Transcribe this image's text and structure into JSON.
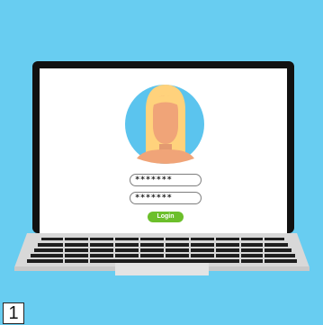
{
  "login_form": {
    "password_mask_1": "*******",
    "password_mask_2": "*******",
    "login_label": "Login"
  },
  "page_number": "1",
  "colors": {
    "background": "#68cdf1",
    "laptop_body": "#d8d8d8",
    "screen_bezel": "#111111",
    "screen": "#ffffff",
    "avatar_circle": "#5bc4ee",
    "hair": "#ffd27c",
    "skin": "#f0a478",
    "login_button": "#6cbf2b"
  },
  "icons": [
    "avatar-icon",
    "keyboard-icon",
    "laptop-icon"
  ]
}
